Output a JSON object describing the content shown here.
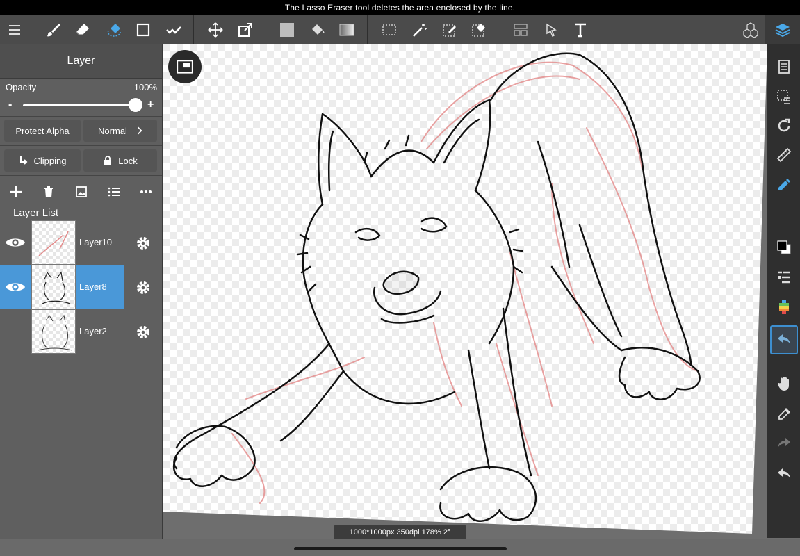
{
  "app": {
    "tip": "The Lasso Eraser tool deletes the area enclosed by the line.",
    "accent_color": "#4a98d8"
  },
  "toolbar": {
    "left_tools": [
      "menu-icon",
      "brush-icon",
      "eraser-icon",
      "lasso-eraser-icon",
      "rectangle-icon",
      "correction-icon",
      "move-icon",
      "transform-icon",
      "fill-color-icon",
      "bucket-icon",
      "gradient-icon",
      "select-rect-icon",
      "magic-wand-icon",
      "select-pen-icon",
      "select-eraser-icon",
      "frame-icon",
      "operation-icon",
      "text-icon"
    ],
    "right_tools": [
      "3d-icon",
      "layers-icon"
    ]
  },
  "panel": {
    "title": "Layer",
    "opacity_label": "Opacity",
    "opacity_value": "100%",
    "opacity_fraction": 1.0,
    "minus": "-",
    "plus": "+",
    "protect_alpha": "Protect Alpha",
    "blend_mode": "Normal",
    "clipping": "Clipping",
    "lock": "Lock",
    "layer_list_title": "Layer List",
    "layers": [
      {
        "name": "Layer10",
        "visible": true,
        "selected": false
      },
      {
        "name": "Layer8",
        "visible": true,
        "selected": true
      },
      {
        "name": "Layer2",
        "visible": false,
        "selected": false
      }
    ]
  },
  "rightbar": {
    "tools": [
      "pages-icon",
      "selection-list-icon",
      "rotate-icon",
      "ruler-icon",
      "pen-snap-icon",
      "color-swatch-icon",
      "brush-list-icon",
      "color-palette-icon",
      "lasso-active-icon",
      "hand-icon",
      "eyedropper-icon",
      "redo-icon",
      "undo-icon"
    ]
  },
  "status": {
    "canvas_info": "1000*1000px 350dpi 178% 2°"
  }
}
